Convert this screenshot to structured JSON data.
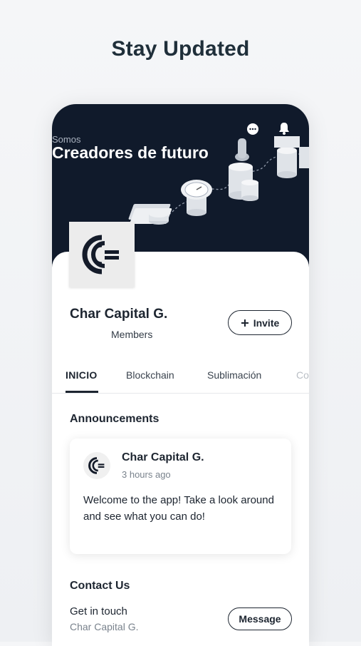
{
  "headline": "Stay Updated",
  "banner": {
    "small_text": "Somos",
    "big_text": "Creadores de futuro"
  },
  "group": {
    "name": "Char Capital G.",
    "members_label": "Members",
    "invite_label": "Invite",
    "invite_icon": "plus-icon"
  },
  "tabs": [
    {
      "label": "INICIO",
      "active": true
    },
    {
      "label": "Blockchain",
      "active": false
    },
    {
      "label": "Sublimación",
      "active": false
    },
    {
      "label": "Co",
      "active": false
    }
  ],
  "announcements": {
    "title": "Announcements",
    "post": {
      "author": "Char Capital G.",
      "time": "3 hours ago",
      "body": "Welcome to the app! Take a look around and see what you can do!"
    }
  },
  "contact": {
    "title": "Contact Us",
    "subtitle": "Get in touch",
    "name": "Char Capital G.",
    "message_label": "Message"
  },
  "colors": {
    "banner_bg": "#101a2b",
    "text_dark": "#1d2530",
    "muted": "#7a838d"
  }
}
